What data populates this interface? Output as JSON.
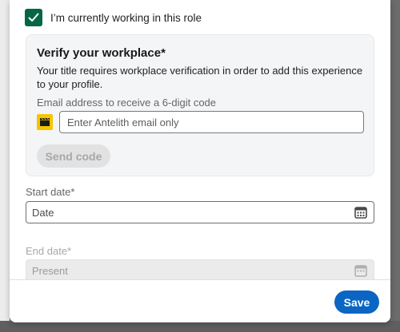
{
  "checkbox": {
    "label": "I’m currently working in this role",
    "checked": true
  },
  "verify": {
    "title": "Verify your workplace*",
    "description": "Your title requires workplace verification in order to add this experience to your profile.",
    "email_label": "Email address to receive a 6-digit code",
    "email_placeholder": "Enter Antelith email only",
    "email_value": "",
    "send_code_label": "Send code"
  },
  "start_date": {
    "label": "Start date*",
    "value": "Date"
  },
  "end_date": {
    "label": "End date*",
    "value": "Present"
  },
  "footer": {
    "save_label": "Save"
  },
  "colors": {
    "accent": "#0a66c2",
    "checkbox_green": "#056644",
    "company_logo": "#f5c400"
  },
  "icons": {
    "check": "checkmark-icon",
    "company": "company-logo-icon",
    "calendar": "calendar-icon"
  }
}
